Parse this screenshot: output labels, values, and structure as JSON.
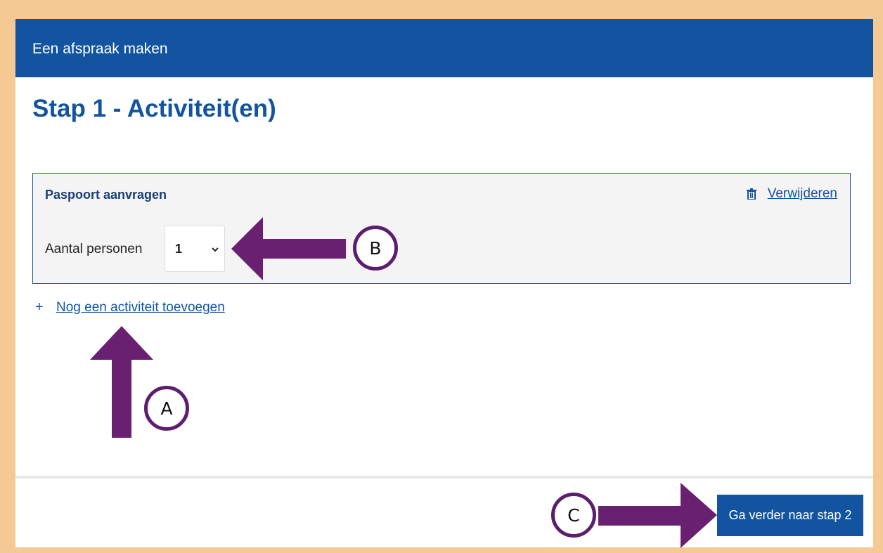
{
  "header": {
    "title": "Een afspraak maken"
  },
  "page": {
    "title": "Stap 1 - Activiteit(en)"
  },
  "activity": {
    "title": "Paspoort aanvragen",
    "remove_label": "Verwijderen",
    "remove_icon": "trash-icon",
    "persons_label": "Aantal personen",
    "persons_value": "1"
  },
  "add_activity": {
    "label": "Nog een activiteit toevoegen",
    "icon": "+"
  },
  "footer": {
    "next_label": "Ga verder naar stap 2"
  },
  "annotations": {
    "a": "A",
    "b": "B",
    "c": "C",
    "arrow_color": "#6a2070"
  },
  "colors": {
    "brand": "#1254a0",
    "frame": "#f5c993"
  }
}
